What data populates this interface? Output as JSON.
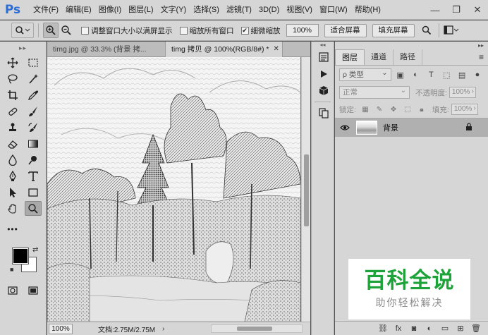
{
  "app": {
    "logo": "Ps"
  },
  "menu": [
    "文件(F)",
    "编辑(E)",
    "图像(I)",
    "图层(L)",
    "文字(Y)",
    "选择(S)",
    "滤镜(T)",
    "3D(D)",
    "视图(V)",
    "窗口(W)",
    "帮助(H)"
  ],
  "window_controls": {
    "minimize": "—",
    "restore": "❐",
    "close": "✕"
  },
  "options": {
    "resize_windows_label": "调整窗口大小以满屏显示",
    "resize_windows_checked": false,
    "zoom_all_label": "缩放所有窗口",
    "zoom_all_checked": false,
    "scrubby_zoom_label": "细微缩放",
    "scrubby_zoom_checked": true,
    "zoom_value": "100%",
    "fit_screen_label": "适合屏幕",
    "fill_screen_label": "填充屏幕"
  },
  "tabs": [
    {
      "label": "timg.jpg @ 33.3% (背景 拷...",
      "active": false,
      "close": ""
    },
    {
      "label": "timg 拷贝 @ 100%(RGB/8#) *",
      "active": true,
      "close": "✕"
    }
  ],
  "status": {
    "zoom": "100%",
    "doc": "文档:2.75M/2.75M",
    "arrow": "›"
  },
  "layers_panel": {
    "tabs": [
      "图层",
      "通道",
      "路径"
    ],
    "filter_kind": "ρ 类型",
    "blend_mode": "正常",
    "opacity_label": "不透明度:",
    "opacity_value": "100%",
    "lock_label": "锁定:",
    "fill_label": "填充:",
    "fill_value": "100%",
    "layers": [
      {
        "name": "背景",
        "visible": true,
        "locked": true
      }
    ]
  },
  "watermark": {
    "main": "百科全说",
    "sub": "助你轻松解决"
  },
  "colors": {
    "foreground": "#000000",
    "background": "#ffffff",
    "watermark_green": "#1ea33a"
  }
}
